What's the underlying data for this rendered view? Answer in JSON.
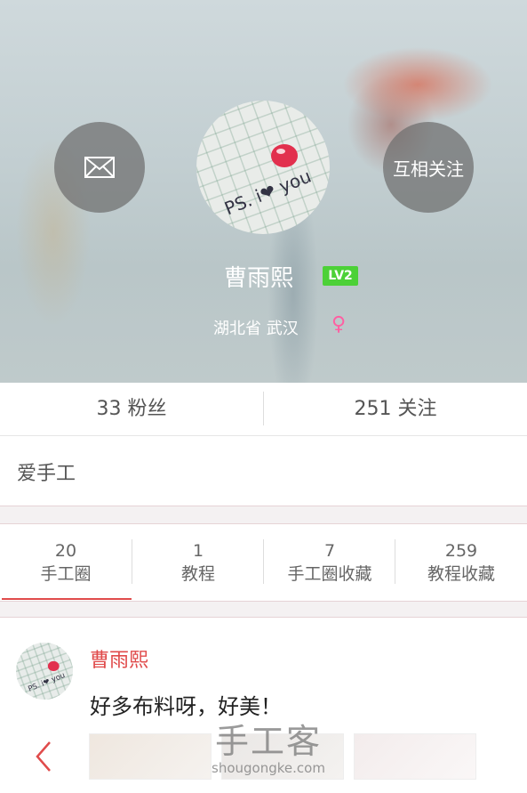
{
  "profile": {
    "username": "曹雨熙",
    "level_badge": "LV2",
    "location": "湖北省  武汉",
    "gender_symbol": "♀",
    "follow_label": "互相关注",
    "avatar_text": "PS. i❤ you"
  },
  "stats": {
    "fans": "33 粉丝",
    "following": "251 关注"
  },
  "bio": "爱手工",
  "tabs": [
    {
      "count": "20",
      "label": "手工圈"
    },
    {
      "count": "1",
      "label": "教程"
    },
    {
      "count": "7",
      "label": "手工圈收藏"
    },
    {
      "count": "259",
      "label": "教程收藏"
    }
  ],
  "post": {
    "author": "曹雨熙",
    "text": "好多布料呀，好美！"
  },
  "watermark": {
    "main": "手工客",
    "sub": "shougongke.com"
  },
  "colors": {
    "accent": "#e04b4b",
    "badge_green": "#4cd137",
    "gender_pink": "#ff5fa2"
  },
  "icons": [
    "mail-icon",
    "back-chevron-icon"
  ]
}
